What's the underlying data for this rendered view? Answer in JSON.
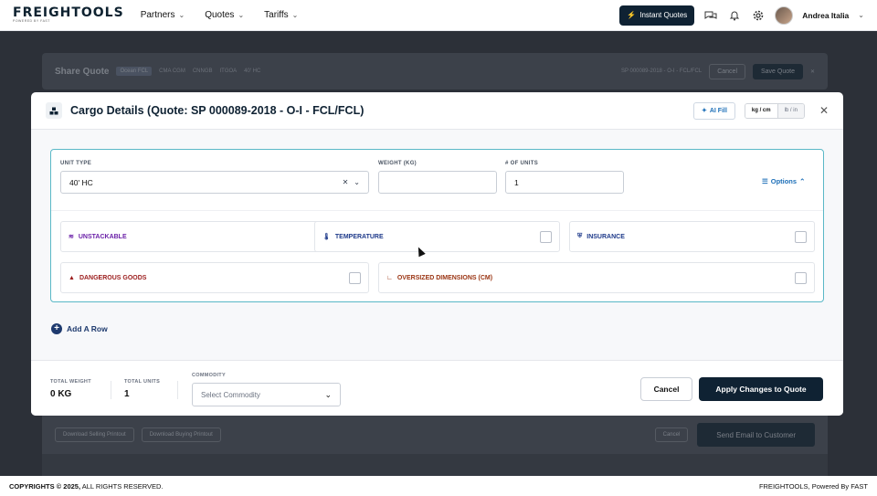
{
  "nav": {
    "logo_text": "FREIGHTOOLS",
    "logo_sub": "POWERED BY FAST",
    "items": [
      {
        "label": "Partners"
      },
      {
        "label": "Quotes"
      },
      {
        "label": "Tariffs"
      }
    ],
    "instant_quotes_label": "Instant Quotes",
    "user_name": "Andrea Italia",
    "icons": [
      "chat-icon",
      "bell-icon",
      "gear-icon"
    ]
  },
  "background": {
    "share_title": "Share Quote",
    "chips": [
      "Ocean FCL",
      "CMA CGM",
      "CNNGB",
      "ITGOA",
      "40' HC"
    ],
    "quote_ref": "SP 000089-2018 - O-I - FCL/FCL",
    "cancel_label": "Cancel",
    "save_label": "Save Quote",
    "download_selling": "Download Selling Printout",
    "download_buying": "Download Buying Printout",
    "cancel_bottom": "Cancel",
    "send_email": "Send Email to Customer"
  },
  "modal": {
    "title": "Cargo Details (Quote: SP 000089-2018 - O-I - FCL/FCL)",
    "ai_fill_label": "AI Fill",
    "units_metric": "kg / cm",
    "units_imperial": "lb / in",
    "unit_type_label": "UNIT TYPE",
    "unit_type_value": "40' HC",
    "weight_label": "WEIGHT (KG)",
    "weight_value": "",
    "units_label": "# OF UNITS",
    "units_value": "1",
    "options_label": "Options",
    "options": [
      {
        "label": "UNSTACKABLE",
        "color": "#6b21a8"
      },
      {
        "label": "TEMPERATURE",
        "color": "#1e3a8a"
      },
      {
        "label": "INSURANCE",
        "color": "#1e3a8a"
      },
      {
        "label": "DANGEROUS GOODS",
        "color": "#9b1c1c"
      },
      {
        "label": "OVERSIZED DIMENSIONS (CM)",
        "color": "#9a3412"
      }
    ],
    "add_row_label": "Add A Row",
    "footer": {
      "total_weight_label": "TOTAL WEIGHT",
      "total_weight_value": "0 KG",
      "total_units_label": "TOTAL UNITS",
      "total_units_value": "1",
      "commodity_label": "COMMODITY",
      "commodity_placeholder": "Select Commodity",
      "cancel_label": "Cancel",
      "apply_label": "Apply Changes to Quote"
    }
  },
  "footer": {
    "copyright_bold": "COPYRIGHTS © 2025,",
    "copyright_rest": " ALL RIGHTS RESERVED.",
    "powered": "FREIGHTOOLS, Powered By FAST"
  },
  "colors": {
    "brand_dark": "#0f2233",
    "accent_teal": "#5ab8c7",
    "link_blue": "#1d6fb8"
  }
}
